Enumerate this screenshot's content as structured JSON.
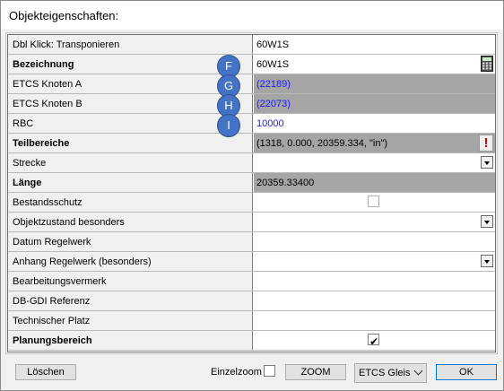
{
  "window": {
    "title": "Objekteigenschaften:"
  },
  "rows": [
    {
      "label": "Dbl Klick: Transponieren",
      "value": "60W1S"
    },
    {
      "label": "Bezeichnung",
      "value": "60W1S",
      "icon": "calculator-icon"
    },
    {
      "label": "ETCS Knoten A",
      "value": "(22189)"
    },
    {
      "label": "ETCS Knoten B",
      "value": "(22073)"
    },
    {
      "label": "RBC",
      "value": "10000"
    },
    {
      "label": "Teilbereiche",
      "value": "(1318, 0.000, 20359.334, \"in\")",
      "icon": "warning-icon"
    },
    {
      "label": "Strecke",
      "value": ""
    },
    {
      "label": "Länge",
      "value": "20359.33400"
    },
    {
      "label": "Bestandsschutz",
      "value": "",
      "checked": false
    },
    {
      "label": "Objektzustand besonders",
      "value": ""
    },
    {
      "label": "Datum Regelwerk",
      "value": ""
    },
    {
      "label": "Anhang Regelwerk (besonders)",
      "value": ""
    },
    {
      "label": "Bearbeitungsvermerk",
      "value": ""
    },
    {
      "label": "DB-GDI Referenz",
      "value": ""
    },
    {
      "label": "Technischer Platz",
      "value": ""
    },
    {
      "label": "Planungsbereich",
      "value": "",
      "checked": true
    }
  ],
  "markers": [
    "F",
    "G",
    "H",
    "I"
  ],
  "footer": {
    "delete_label": "Löschen",
    "einzelzoom_label": "Einzelzoom",
    "einzelzoom_checked": false,
    "zoom_label": "ZOOM",
    "layer_selected": "ETCS Gleis",
    "ok_label": "OK"
  },
  "colors": {
    "readonly_gray": "#a5a5a5",
    "link_blue": "#1a1aff",
    "marker_blue": "#4472c4",
    "warning_red": "#d40000"
  }
}
